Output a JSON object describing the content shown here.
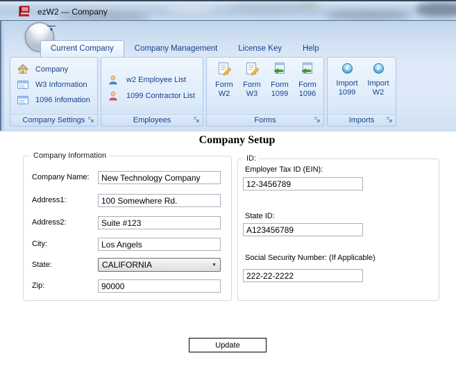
{
  "colors": {
    "accent_text": "#15428b",
    "title_text": "#101010",
    "ribbon_border": "#a9c6e8",
    "app_icon_red": "#d51c1c"
  },
  "icons": {
    "qat_arrow": "▾",
    "combo_arrow": "▼",
    "import_arrow": "▲"
  },
  "window": {
    "title": "ezW2 --- Company"
  },
  "tabs": [
    {
      "label": "Current Company",
      "selected": true
    },
    {
      "label": "Company Management",
      "selected": false
    },
    {
      "label": "License Key",
      "selected": false
    },
    {
      "label": "Help",
      "selected": false
    }
  ],
  "ribbon": {
    "groups": [
      {
        "label": "Company Settings",
        "items": [
          {
            "label": "Company",
            "icon": "home-icon"
          },
          {
            "label": "W3 Information",
            "icon": "table-icon"
          },
          {
            "label": "1096 Infomation",
            "icon": "table-icon"
          }
        ]
      },
      {
        "label": "Employees",
        "items": [
          {
            "label": "w2 Employee List",
            "icon": "person-blue-icon"
          },
          {
            "label": "1099 Contractor List",
            "icon": "person-red-icon"
          }
        ]
      },
      {
        "label": "Forms",
        "items": [
          {
            "label": "Form\nW2",
            "icon": "form-edit-icon"
          },
          {
            "label": "Form\nW3",
            "icon": "form-edit-icon"
          },
          {
            "label": "Form\n1099",
            "icon": "form-import-icon"
          },
          {
            "label": "Form\n1096",
            "icon": "form-import-icon"
          }
        ]
      },
      {
        "label": "Imports",
        "items": [
          {
            "label": "Import\n1099",
            "icon": "import-up-icon"
          },
          {
            "label": "Import\nW2",
            "icon": "import-up-icon"
          }
        ]
      }
    ]
  },
  "content": {
    "heading": "Company Setup",
    "company_info": {
      "legend": "Company Information",
      "fields": [
        {
          "label": "Company Name:",
          "value": "New Technology Company"
        },
        {
          "label": "Address1:",
          "value": "100 Somewhere Rd."
        },
        {
          "label": "Address2:",
          "value": "Suite #123"
        },
        {
          "label": "City:",
          "value": "Los Angels"
        },
        {
          "label": "State:",
          "value": "CALIFORNIA"
        },
        {
          "label": "Zip:",
          "value": "90000"
        }
      ]
    },
    "id_info": {
      "legend": "ID:",
      "fields": [
        {
          "label": "Employer Tax ID (EIN):",
          "value": "12-3456789"
        },
        {
          "label": "State ID:",
          "value": "A123456789"
        },
        {
          "label": "Social Security Number: (If Applicable)",
          "value": "222-22-2222"
        }
      ]
    },
    "update_button": "Update"
  }
}
